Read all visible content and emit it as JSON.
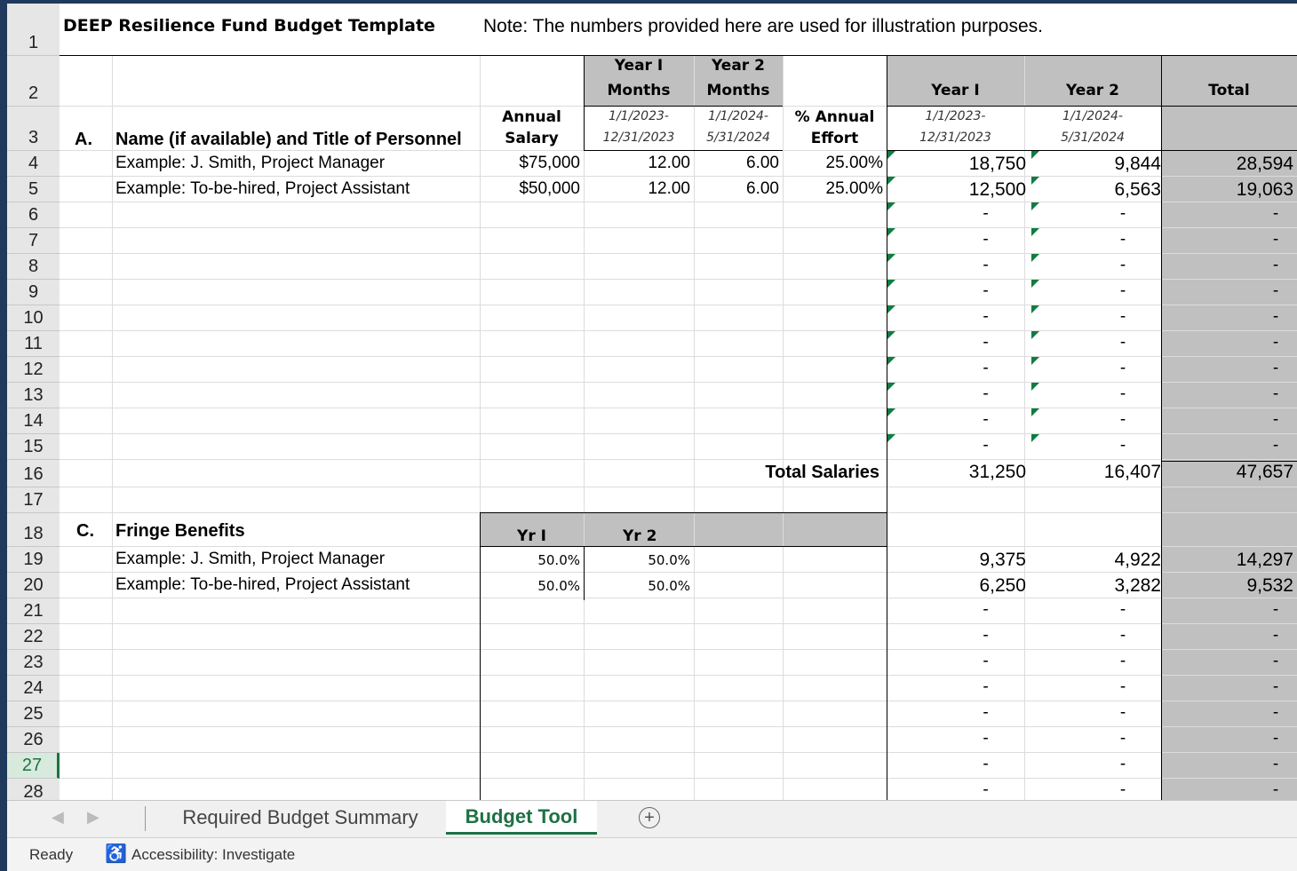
{
  "header": {
    "title": "DEEP Resilience Fund Budget Template",
    "note": "Note: The numbers provided here are used for illustration purposes."
  },
  "columns": {
    "year1_months_l1": "Year I",
    "year1_months_l2": "Months",
    "year2_months_l1": "Year 2",
    "year2_months_l2": "Months",
    "year1": "Year I",
    "year2": "Year 2",
    "total": "Total",
    "annual_salary_l1": "Annual",
    "annual_salary_l2": "Salary",
    "period1_l1": "1/1/2023-",
    "period1_l2": "12/31/2023",
    "period2_l1": "1/1/2024-",
    "period2_l2": "5/31/2024",
    "effort_l1": "% Annual",
    "effort_l2": "Effort"
  },
  "section_a": {
    "letter": "A.",
    "heading": "Name (if available) and Title of Personnel",
    "rows": [
      {
        "name": "Example: J. Smith, Project Manager",
        "salary": "$75,000",
        "m1": "12.00",
        "m2": "6.00",
        "effort": "25.00%",
        "y1": "18,750",
        "y2": "9,844",
        "total": "28,594"
      },
      {
        "name": "Example: To-be-hired, Project Assistant",
        "salary": "$50,000",
        "m1": "12.00",
        "m2": "6.00",
        "effort": "25.00%",
        "y1": "12,500",
        "y2": "6,563",
        "total": "19,063"
      }
    ],
    "dash": "-",
    "total_label": "Total Salaries",
    "total_y1": "31,250",
    "total_y2": "16,407",
    "total_all": "47,657"
  },
  "section_c": {
    "letter": "C.",
    "heading": "Fringe Benefits",
    "yr1": "Yr I",
    "yr2": "Yr 2",
    "rows": [
      {
        "name": "Example: J. Smith, Project Manager",
        "r1": "50.0%",
        "r2": "50.0%",
        "y1": "9,375",
        "y2": "4,922",
        "total": "14,297"
      },
      {
        "name": "Example: To-be-hired, Project Assistant",
        "r1": "50.0%",
        "r2": "50.0%",
        "y1": "6,250",
        "y2": "3,282",
        "total": "9,532"
      }
    ]
  },
  "row_numbers": [
    "1",
    "2",
    "3",
    "4",
    "5",
    "6",
    "7",
    "8",
    "9",
    "10",
    "11",
    "12",
    "13",
    "14",
    "15",
    "16",
    "17",
    "18",
    "19",
    "20",
    "21",
    "22",
    "23",
    "24",
    "25",
    "26",
    "27",
    "28"
  ],
  "active_row": "27",
  "tabs": {
    "summary": "Required Budget Summary",
    "budget_tool": "Budget Tool",
    "add": "+"
  },
  "status": {
    "ready": "Ready",
    "accessibility": "Accessibility: Investigate"
  },
  "colors": {
    "header_gray": "#c0c0c0",
    "accent_green": "#1e7145",
    "error_triangle": "#107c41"
  }
}
